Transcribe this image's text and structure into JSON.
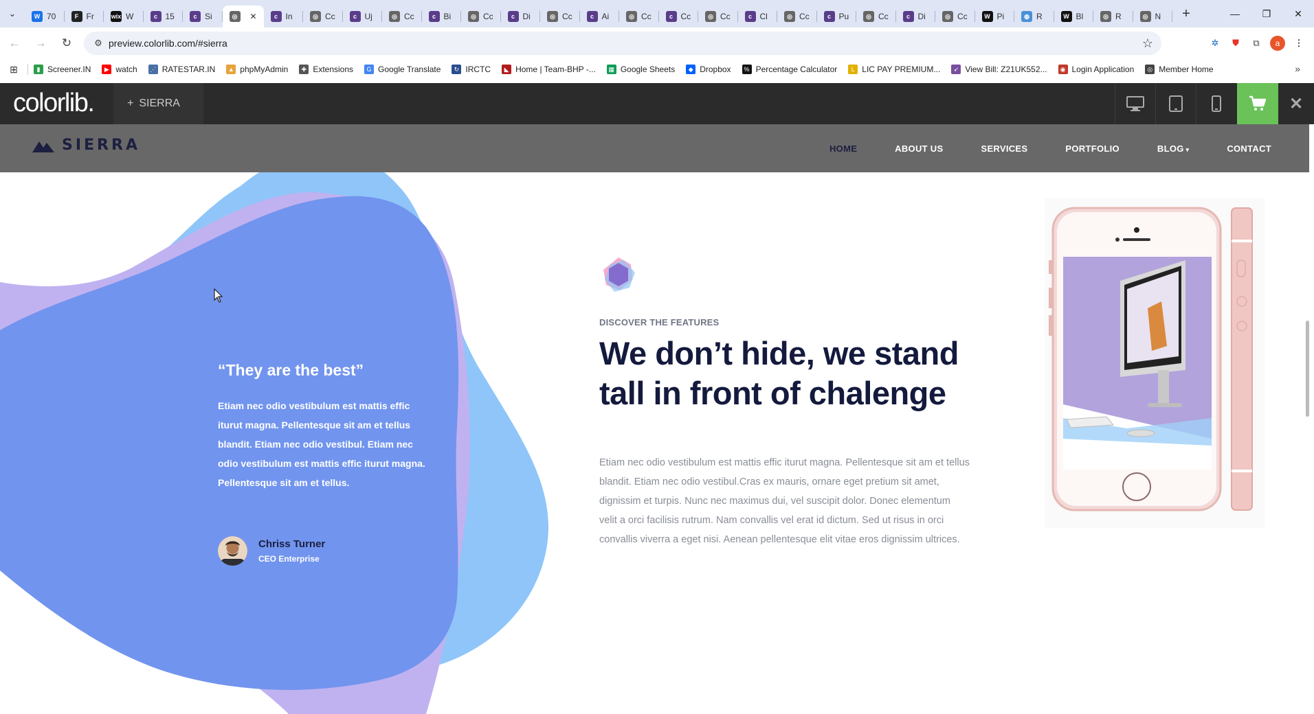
{
  "browser": {
    "tabs": [
      {
        "label": "70",
        "icon_text": "W",
        "icon_color": "#1a73e8"
      },
      {
        "label": "Fr",
        "icon_text": "F",
        "icon_color": "#222222"
      },
      {
        "label": "W",
        "icon_text": "wix",
        "icon_color": "#111111"
      },
      {
        "label": "15",
        "icon_text": "c",
        "icon_color": "#5a3d8a"
      },
      {
        "label": "Si",
        "icon_text": "c",
        "icon_color": "#5a3d8a"
      },
      {
        "label": "",
        "icon_text": "◎",
        "icon_color": "#666666",
        "active": true
      },
      {
        "label": "In",
        "icon_text": "c",
        "icon_color": "#5a3d8a"
      },
      {
        "label": "Cc",
        "icon_text": "◎",
        "icon_color": "#666666"
      },
      {
        "label": "Uj",
        "icon_text": "c",
        "icon_color": "#5a3d8a"
      },
      {
        "label": "Cc",
        "icon_text": "◎",
        "icon_color": "#666666"
      },
      {
        "label": "Bi",
        "icon_text": "c",
        "icon_color": "#5a3d8a"
      },
      {
        "label": "Cc",
        "icon_text": "◎",
        "icon_color": "#666666"
      },
      {
        "label": "Di",
        "icon_text": "c",
        "icon_color": "#5a3d8a"
      },
      {
        "label": "Cc",
        "icon_text": "◎",
        "icon_color": "#666666"
      },
      {
        "label": "Ai",
        "icon_text": "c",
        "icon_color": "#5a3d8a"
      },
      {
        "label": "Cc",
        "icon_text": "◎",
        "icon_color": "#666666"
      },
      {
        "label": "Cc",
        "icon_text": "c",
        "icon_color": "#5a3d8a"
      },
      {
        "label": "Cc",
        "icon_text": "◎",
        "icon_color": "#666666"
      },
      {
        "label": "Cl",
        "icon_text": "c",
        "icon_color": "#5a3d8a"
      },
      {
        "label": "Cc",
        "icon_text": "◎",
        "icon_color": "#666666"
      },
      {
        "label": "Pu",
        "icon_text": "c",
        "icon_color": "#5a3d8a"
      },
      {
        "label": "Cc",
        "icon_text": "◎",
        "icon_color": "#666666"
      },
      {
        "label": "Di",
        "icon_text": "c",
        "icon_color": "#5a3d8a"
      },
      {
        "label": "Cc",
        "icon_text": "◎",
        "icon_color": "#666666"
      },
      {
        "label": "Pi",
        "icon_text": "W",
        "icon_color": "#111111"
      },
      {
        "label": "R",
        "icon_text": "◍",
        "icon_color": "#4a90d9"
      },
      {
        "label": "Bl",
        "icon_text": "W",
        "icon_color": "#111111"
      },
      {
        "label": "R",
        "icon_text": "◎",
        "icon_color": "#666666"
      },
      {
        "label": "N",
        "icon_text": "◎",
        "icon_color": "#666666"
      }
    ],
    "url": "preview.colorlib.com/#sierra",
    "bookmarks": [
      {
        "label": "Screener.IN",
        "icon_color": "#2d9d4b",
        "icon_text": "▮"
      },
      {
        "label": "watch",
        "icon_color": "#ff0000",
        "icon_text": "▶"
      },
      {
        "label": "RATESTAR.IN",
        "icon_color": "#4a6fa5",
        "icon_text": "⋰"
      },
      {
        "label": "phpMyAdmin",
        "icon_color": "#e8a33d",
        "icon_text": "▲"
      },
      {
        "label": "Extensions",
        "icon_color": "#555555",
        "icon_text": "✚"
      },
      {
        "label": "Google Translate",
        "icon_color": "#4285f4",
        "icon_text": "G"
      },
      {
        "label": "IRCTC",
        "icon_color": "#2a4d8f",
        "icon_text": "↻"
      },
      {
        "label": "Home | Team-BHP -...",
        "icon_color": "#b31b1b",
        "icon_text": "◣"
      },
      {
        "label": "Google Sheets",
        "icon_color": "#0f9d58",
        "icon_text": "▦"
      },
      {
        "label": "Dropbox",
        "icon_color": "#0061ff",
        "icon_text": "◆"
      },
      {
        "label": "Percentage Calculator",
        "icon_color": "#111111",
        "icon_text": "%"
      },
      {
        "label": "LIC PAY PREMIUM...",
        "icon_color": "#e2b100",
        "icon_text": "L"
      },
      {
        "label": "View Bill: Z21UK552...",
        "icon_color": "#7a4fa0",
        "icon_text": "➶"
      },
      {
        "label": "Login Application",
        "icon_color": "#c0392b",
        "icon_text": "◉"
      },
      {
        "label": "Member Home",
        "icon_color": "#444444",
        "icon_text": "◎"
      }
    ]
  },
  "preview_bar": {
    "logo": "colorlib.",
    "theme_tab": "SIERRA",
    "theme_tab_plus": "+"
  },
  "site": {
    "brand": "SIERRA",
    "nav": [
      {
        "label": "HOME",
        "active": true
      },
      {
        "label": "ABOUT US",
        "active": false
      },
      {
        "label": "SERVICES",
        "active": false
      },
      {
        "label": "PORTFOLIO",
        "active": false
      },
      {
        "label": "BLOG",
        "active": false,
        "dropdown": true
      },
      {
        "label": "CONTACT",
        "active": false
      }
    ],
    "testimonial": {
      "quote": "“They are the best”",
      "text": "Etiam nec odio vestibulum est mattis effic iturut magna. Pellentesque sit am et tellus blandit. Etiam nec odio vestibul. Etiam nec odio vestibulum est mattis effic iturut magna. Pellentesque sit am et tellus.",
      "author_name": "Chriss Turner",
      "author_role": "CEO Enterprise"
    },
    "feature": {
      "eyebrow": "DISCOVER THE FEATURES",
      "heading_line1": "We don’t hide, we stand",
      "heading_line2": "tall in front of chalenge",
      "body": "Etiam nec odio vestibulum est mattis effic iturut magna. Pellentesque sit am et tellus blandit. Etiam nec odio vestibul.Cras ex mauris, ornare eget pretium sit amet, dignissim et turpis. Nunc nec maximus dui, vel suscipit dolor. Donec elementum velit a orci facilisis rutrum. Nam convallis vel erat id dictum. Sed ut risus in orci convallis viverra a eget nisi. Aenean pellentesque elit vitae eros dignissim ultrices."
    }
  },
  "colors": {
    "blob_light_blue": "#8fc5f9",
    "blob_lavender": "#c0b2f0",
    "blob_mid_blue": "#7194ee",
    "heading": "#141a3d",
    "preview_bar": "#2b2b2b",
    "cart": "#6ac259"
  }
}
